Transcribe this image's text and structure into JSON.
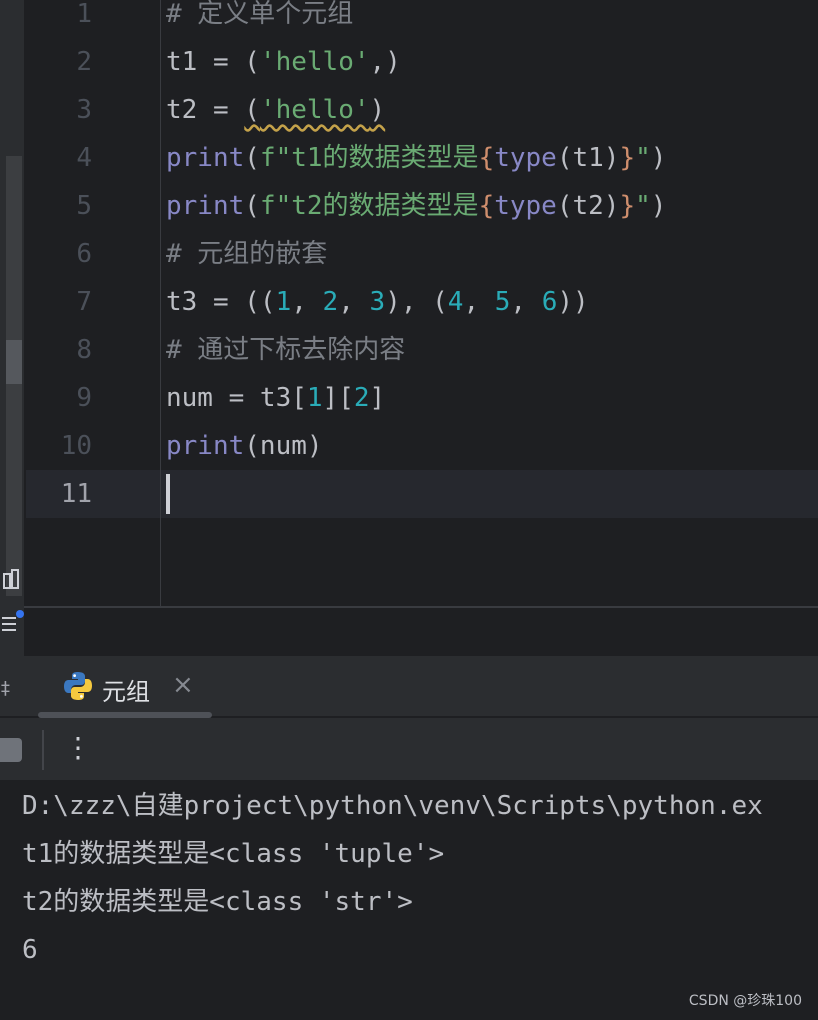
{
  "editor": {
    "lines": [
      {
        "number": "1",
        "tokens": [
          {
            "t": "# 定义单个元组",
            "c": "comment"
          }
        ]
      },
      {
        "number": "2",
        "tokens": [
          {
            "t": "t1 = (",
            "c": "plain"
          },
          {
            "t": "'hello'",
            "c": "str"
          },
          {
            "t": ",)",
            "c": "plain"
          }
        ]
      },
      {
        "number": "3",
        "tokens": [
          {
            "t": "t2 = ",
            "c": "plain"
          },
          {
            "t": "(",
            "c": "plain squiggle"
          },
          {
            "t": "'hello'",
            "c": "str squiggle"
          },
          {
            "t": ")",
            "c": "plain squiggle"
          }
        ]
      },
      {
        "number": "4",
        "tokens": [
          {
            "t": "print",
            "c": "fn"
          },
          {
            "t": "(",
            "c": "plain"
          },
          {
            "t": "f\"t1的数据类型是",
            "c": "str"
          },
          {
            "t": "{",
            "c": "brace"
          },
          {
            "t": "type",
            "c": "fn"
          },
          {
            "t": "(t1)",
            "c": "plain"
          },
          {
            "t": "}",
            "c": "brace"
          },
          {
            "t": "\"",
            "c": "str"
          },
          {
            "t": ")",
            "c": "plain"
          }
        ]
      },
      {
        "number": "5",
        "tokens": [
          {
            "t": "print",
            "c": "fn"
          },
          {
            "t": "(",
            "c": "plain"
          },
          {
            "t": "f\"t2的数据类型是",
            "c": "str"
          },
          {
            "t": "{",
            "c": "brace"
          },
          {
            "t": "type",
            "c": "fn"
          },
          {
            "t": "(t2)",
            "c": "plain"
          },
          {
            "t": "}",
            "c": "brace"
          },
          {
            "t": "\"",
            "c": "str"
          },
          {
            "t": ")",
            "c": "plain"
          }
        ]
      },
      {
        "number": "6",
        "tokens": [
          {
            "t": "# 元组的嵌套",
            "c": "comment"
          }
        ]
      },
      {
        "number": "7",
        "tokens": [
          {
            "t": "t3 = ((",
            "c": "plain"
          },
          {
            "t": "1",
            "c": "num"
          },
          {
            "t": ", ",
            "c": "plain"
          },
          {
            "t": "2",
            "c": "num"
          },
          {
            "t": ", ",
            "c": "plain"
          },
          {
            "t": "3",
            "c": "num"
          },
          {
            "t": "), (",
            "c": "plain"
          },
          {
            "t": "4",
            "c": "num"
          },
          {
            "t": ", ",
            "c": "plain"
          },
          {
            "t": "5",
            "c": "num"
          },
          {
            "t": ", ",
            "c": "plain"
          },
          {
            "t": "6",
            "c": "num"
          },
          {
            "t": "))",
            "c": "plain"
          }
        ]
      },
      {
        "number": "8",
        "tokens": [
          {
            "t": "# 通过下标去除内容",
            "c": "comment"
          }
        ]
      },
      {
        "number": "9",
        "tokens": [
          {
            "t": "num = t3[",
            "c": "plain"
          },
          {
            "t": "1",
            "c": "num"
          },
          {
            "t": "][",
            "c": "plain"
          },
          {
            "t": "2",
            "c": "num"
          },
          {
            "t": "]",
            "c": "plain"
          }
        ]
      },
      {
        "number": "10",
        "tokens": [
          {
            "t": "print",
            "c": "fn"
          },
          {
            "t": "(num)",
            "c": "plain"
          }
        ]
      },
      {
        "number": "11",
        "tokens": []
      }
    ],
    "active_line": "11"
  },
  "run_panel": {
    "tab_label": "元组",
    "close_glyph": "×",
    "more_glyph": "⋮",
    "left_mark": "‡",
    "output": [
      "D:\\zzz\\自建project\\python\\venv\\Scripts\\python.ex",
      "t1的数据类型是<class 'tuple'>",
      "t2的数据类型是<class 'str'>",
      "6"
    ]
  },
  "watermark": "CSDN @珍珠100",
  "colors": {
    "background": "#1e1f22",
    "panel": "#2b2d30",
    "comment": "#7a7e85",
    "string": "#6aab73",
    "number": "#2aacb8",
    "function": "#8888c6",
    "brace": "#cf8e6d",
    "text": "#bcbec4"
  }
}
